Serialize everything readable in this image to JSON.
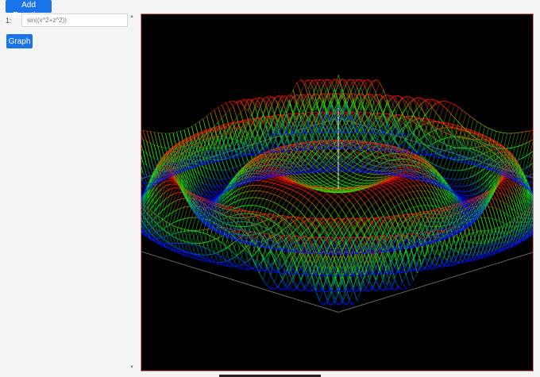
{
  "toolbar": {
    "add_equation_label": "Add Equation",
    "graph_label": "Graph"
  },
  "equations": [
    {
      "index": "1:",
      "value": "",
      "placeholder": "sin((x^2+z^2))"
    }
  ],
  "plot": {
    "background": "#000000",
    "border_color": "#e57373"
  },
  "icons": {
    "scroll_up": "scroll-up-arrow-icon",
    "scroll_down": "scroll-down-arrow-icon"
  },
  "colors": {
    "button": "#1a73e8",
    "surface_low": "#2233ff",
    "surface_mid": "#00ff2a",
    "surface_high": "#ff2a1a"
  }
}
